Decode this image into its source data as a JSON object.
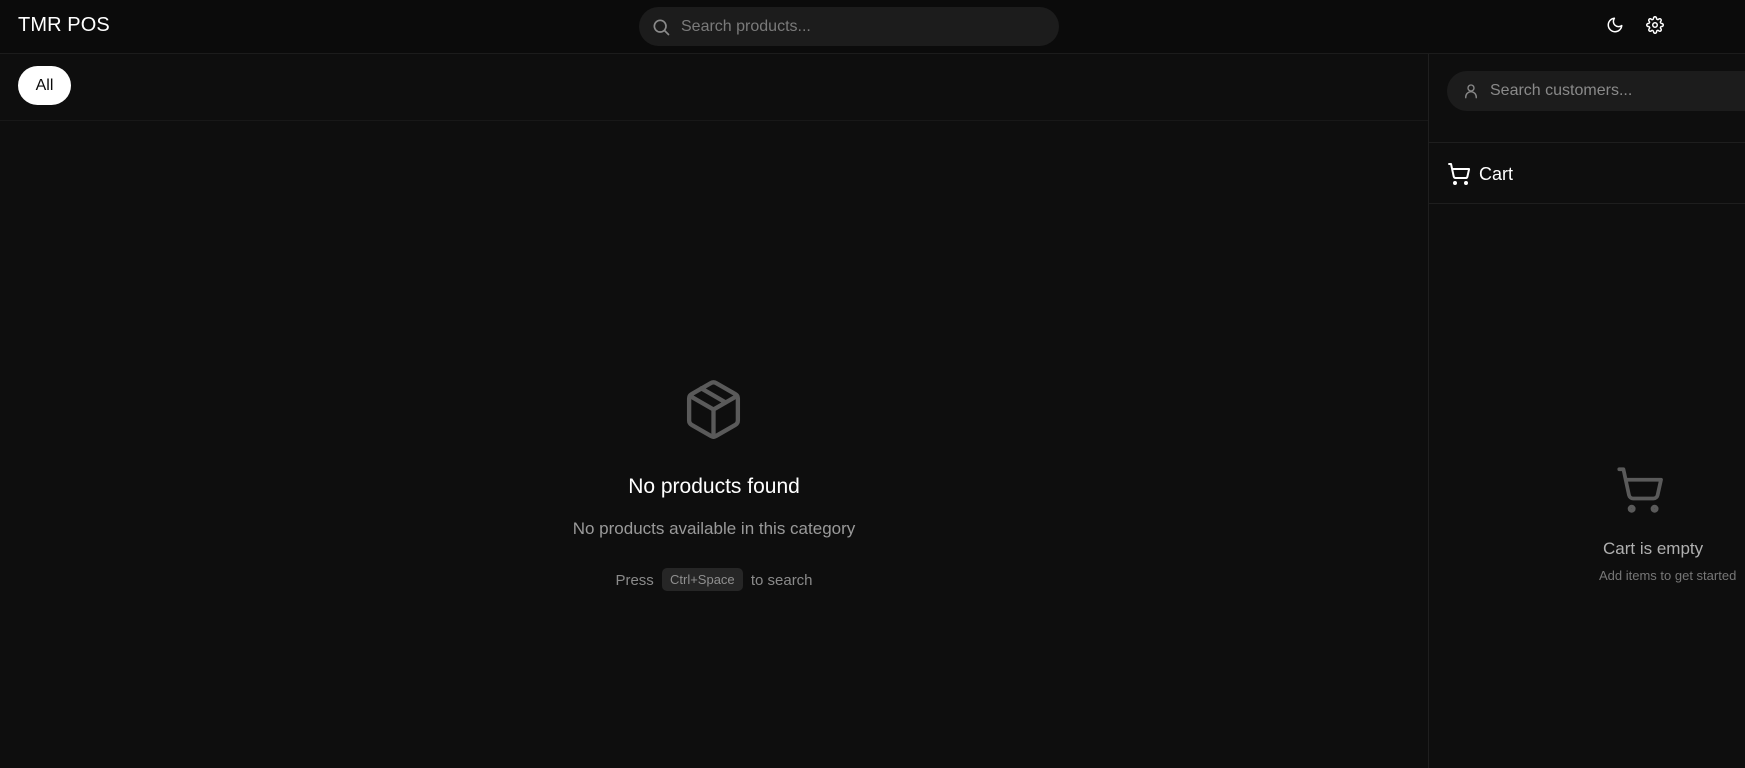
{
  "header": {
    "brand": "TMR POS",
    "search_placeholder": "Search products...",
    "icons": [
      "search-icon",
      "moon-icon",
      "gear-icon"
    ]
  },
  "categories": {
    "items": [
      {
        "label": "All",
        "active": true
      }
    ]
  },
  "products_empty": {
    "title": "No products found",
    "subtitle": "No products available in this category",
    "hint_prefix": "Press",
    "shortcut": "Ctrl+Space",
    "hint_suffix": "to search",
    "icon": "box-icon"
  },
  "customer": {
    "search_placeholder": "Search customers...",
    "icon": "user-icon"
  },
  "cart": {
    "title": "Cart",
    "empty_title": "Cart is empty",
    "empty_subtitle": "Add items to get started",
    "icon": "cart-icon"
  },
  "colors": {
    "background": "#0e0e0e",
    "surface": "#1c1c1c",
    "active_chip": "#ffffff",
    "text_primary": "#ffffff",
    "text_muted": "#9a9a9a"
  }
}
